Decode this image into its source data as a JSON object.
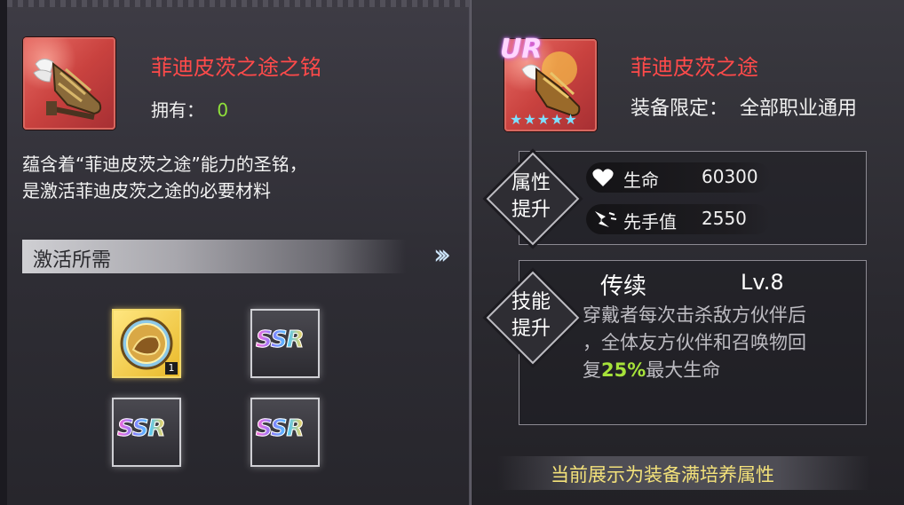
{
  "left": {
    "item_title": "菲迪皮茨之途之铭",
    "owned_label": "拥有：",
    "owned_count": "0",
    "desc_line1": "蕴含着“菲迪皮茨之途”能力的圣铭，",
    "desc_line2": "是激活菲迪皮茨之途的必要材料",
    "requirement_header": "激活所需",
    "slots": [
      {
        "type": "gold",
        "badge": "1"
      },
      {
        "type": "ssr",
        "label": "SSR"
      },
      {
        "type": "ssr",
        "label": "SSR"
      },
      {
        "type": "ssr",
        "label": "SSR"
      }
    ]
  },
  "right": {
    "rarity": "UR",
    "stars": "★★★★★",
    "equip_title": "菲迪皮茨之途",
    "limit_label": "装备限定：",
    "limit_value": "全部职业通用",
    "attr_section": {
      "line1": "属性",
      "line2": "提升"
    },
    "attributes": [
      {
        "icon": "heart-icon",
        "name": "生命",
        "value": "60300"
      },
      {
        "icon": "speed-icon",
        "name": "先手值",
        "value": "2550"
      }
    ],
    "skill_section": {
      "line1": "技能",
      "line2": "提升"
    },
    "skill": {
      "name": "传续",
      "level": "Lv.8",
      "desc_a": "穿戴者每次击杀敌方伙伴后",
      "desc_b": "，全体友方伙伴和召唤物回",
      "desc_c1": "复",
      "desc_highlight": "25%",
      "desc_c2": "最大生命"
    },
    "footer_note": "当前展示为装备满培养属性"
  },
  "colors": {
    "title_red": "#ff4a4a",
    "owned_green": "#8fe03a",
    "highlight_green": "#a6e23a",
    "footer_yellow": "#f4e27a"
  }
}
